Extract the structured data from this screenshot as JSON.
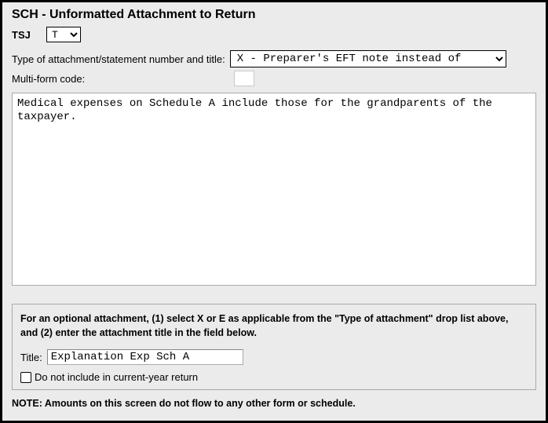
{
  "header": {
    "title": "SCH - Unformatted Attachment to Return"
  },
  "tsj": {
    "label": "TSJ",
    "value": "T"
  },
  "type": {
    "label": "Type of attachment/statement number and title:",
    "value": "X - Preparer's EFT note instead of"
  },
  "multiform": {
    "label": "Multi-form code:",
    "value": ""
  },
  "body": {
    "text": "Medical expenses on Schedule A include those for the grandparents of the taxpayer."
  },
  "optional": {
    "instruction": "For an optional attachment, (1) select X or E as applicable from the \"Type of attachment\" drop list above, and (2) enter the attachment title in the field below.",
    "title_label": "Title:",
    "title_value": "Explanation Exp Sch A",
    "checkbox_label": "Do not include in current-year return"
  },
  "footer": {
    "note": "NOTE: Amounts on this screen do not flow to any other form or schedule."
  }
}
